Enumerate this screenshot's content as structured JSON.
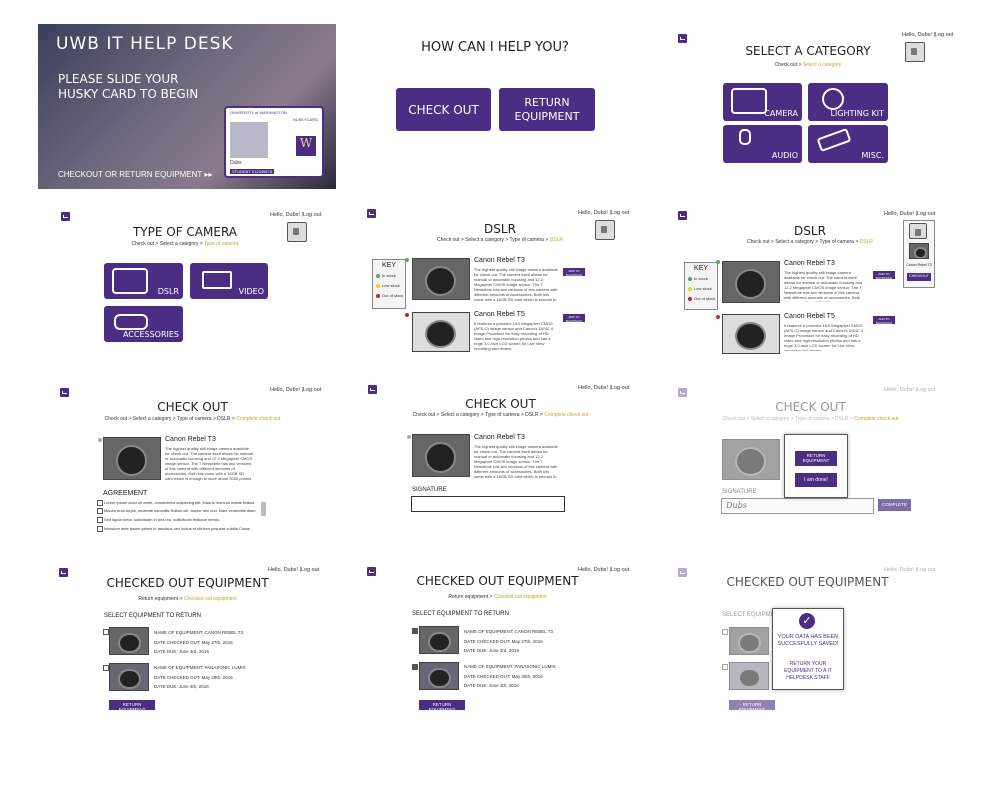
{
  "user": {
    "greeting": "Hello, Dubs! |Log out",
    "greeting_short": "Hello, Dubs!",
    "logout": "| Log out"
  },
  "welcome": {
    "title": "UWB IT HELP DESK",
    "prompt_line1": "PLEASE SLIDE YOUR",
    "prompt_line2": "HUSKY CARD TO BEGIN",
    "footer": "CHECKOUT OR RETURN EQUIPMENT ▸▸",
    "card_univ": "UNIVERSITY of WASHINGTON",
    "card_type": "HUSKYCARD",
    "card_name": "Dubs",
    "card_student": "STUDENT 012345678"
  },
  "help": {
    "title": "HOW CAN I HELP YOU?",
    "checkout": "CHECK OUT",
    "return_line1": "RETURN",
    "return_line2": "EQUIPMENT"
  },
  "category": {
    "title": "SELECT A CATEGORY",
    "crumb_prefix": "Check out > ",
    "crumb_current": "Select a category",
    "tiles": [
      "CAMERA",
      "LIGHTING KIT",
      "AUDIO",
      "MISC."
    ]
  },
  "camera_type": {
    "title": "TYPE OF CAMERA",
    "crumb_prefix": "Check out > Select a category > ",
    "crumb_current": "Type of camera",
    "tiles": [
      "DSLR",
      "VIDEO",
      "ACCESSORIES"
    ]
  },
  "dslr": {
    "title": "DSLR",
    "crumb_prefix": "Check out > Select a category > Type of camera > ",
    "crumb_current": "DSLR",
    "key_title": "KEY",
    "key": [
      "In stock",
      "Low stock",
      "Out of stock"
    ],
    "colors": {
      "in": "#4caf50",
      "low": "#f0d020",
      "out": "#c0282d"
    },
    "products": [
      {
        "name": "Canon Rebel T3",
        "desc": "The highest quality still image camera available for check out. The camera itself allows for manual or automatic focusing and 12.2 Megapixel CMOS image sensor. The T Nessebrie has two versions of this camera with different amounts of accessories. Both kits come with a 16GB SD card which is enough to store about 3000 photos at maximum quality.",
        "add": "ADD TO BACKPACK"
      },
      {
        "name": "Canon Rebel T5",
        "desc": "It features a powerful 18.0 Megapixel CMOS (APS-C) image sensor and Canon's DIGIC 4 Image Processor for easy recording of HD video and high-resolution photos and has a huge 3.0-inch LCD screen for Live View recording and review.",
        "add": "ADD TO BACKPACK"
      }
    ],
    "cart_item": "Canon Rebel T3",
    "checkout_btn": "CHECKOUT"
  },
  "checkout": {
    "title": "CHECK OUT",
    "crumb_prefix": "Check out > Select a category > Type of camera > DSLR > ",
    "crumb_current": "Complete check out",
    "agreement_title": "AGREEMENT",
    "agreement": [
      "Lorem ipsum dolor sit amet, consectetur adipiscing elit. Mauris rhoncus mattis finibus.",
      "Mauris eros turpis, molestie convallis finibus vel, auctor nec orci. Nam venenatis diam.",
      "Sed ligula tortor, sollicitudin in arcu eu, sollicitudin tristique metus.",
      "Interdum ante ipsum primis in faucibus orci luctus et ultrices posuere cubilia Curae."
    ],
    "signature": "SIGNATURE",
    "signature_value": "Dubs",
    "complete": "COMPLETE",
    "return_equipment": "RETURN EQUIPMENT",
    "done": "I am done!"
  },
  "returns": {
    "title": "CHECKED OUT EQUIPMENT",
    "crumb_prefix": "Return equipment > ",
    "crumb_current": "Checked out equipment",
    "select_label": "SELECT EQUIPMENT TO RETURN",
    "items": [
      {
        "name": "NAME OF EQUIPMENT: CANON REBEL T3",
        "checked_out": "DATE CHECKED OUT: May 27th, 2016",
        "due": "DATE DUE: June 3rd, 2016"
      },
      {
        "name": "NAME OF EQUIPMENT: PANASONIC LUMIX",
        "checked_out": "DATE CHECKED OUT: May 28th, 2016",
        "due": "DATE DUE: June 4th, 2016"
      }
    ],
    "return_btn": "RETURN EQUIPMENT",
    "saved_line1": "YOUR DATA HAS BEEN SUCCESFULLY SAVED!",
    "saved_line2": "RETURN YOUR EQUIPMENT TO A IT HELPDESK STAFF"
  }
}
